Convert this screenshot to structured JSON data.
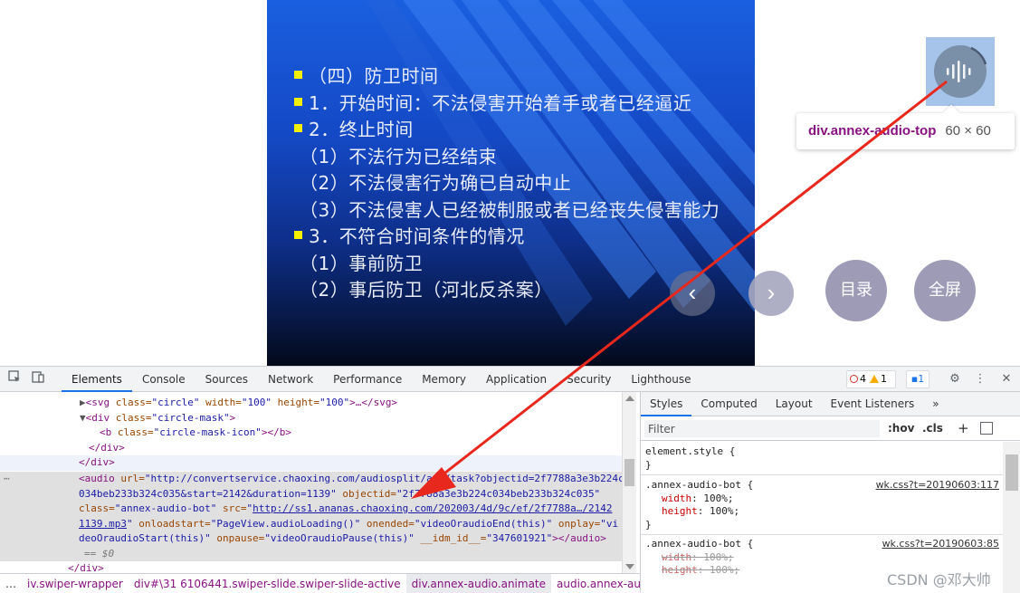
{
  "slide": {
    "lines": [
      {
        "text": "（四）防卫时间",
        "bullet": true
      },
      {
        "text": "1．开始时间：不法侵害开始着手或者已经逼近",
        "bullet": true
      },
      {
        "text": "2．终止时间",
        "bullet": true
      },
      {
        "text": "（1）不法行为已经结束",
        "bullet": false
      },
      {
        "text": "（2）不法侵害行为确已自动中止",
        "bullet": false
      },
      {
        "text": "（3）不法侵害人已经被制服或者已经丧失侵害能力",
        "bullet": false
      },
      {
        "text": "3．不符合时间条件的情况",
        "bullet": true
      },
      {
        "text": "（1）事前防卫",
        "bullet": false
      },
      {
        "text": "（2）事后防卫（河北反杀案）",
        "bullet": false
      }
    ],
    "bullet_color": "#f5f000",
    "text_color": "#e8ecf8"
  },
  "controls": {
    "prev_glyph": "‹",
    "next_glyph": "›",
    "catalog_label": "目录",
    "fullscreen_label": "全屏",
    "button_color": "#9e9bb7"
  },
  "audio_icon": {
    "name": "audio-wave-icon",
    "highlight_color": "#a6c4ea"
  },
  "tooltip": {
    "selector": "div.annex-audio-top",
    "size": "60 × 60"
  },
  "devtools": {
    "tabs": [
      "Elements",
      "Console",
      "Sources",
      "Network",
      "Performance",
      "Memory",
      "Application",
      "Security",
      "Lighthouse"
    ],
    "active_tab": "Elements",
    "errors": "4",
    "warnings": "1",
    "messages": "1",
    "elements": {
      "lines": {
        "l1_open": "<svg ",
        "l1_attr1": "class=",
        "l1_val1": "\"circle\"",
        "l1_attr2": " width=",
        "l1_val2": "\"100\"",
        "l1_attr3": " height=",
        "l1_val3": "\"100\"",
        "l1_close": ">…</svg>",
        "l2_open": "<div ",
        "l2_attr": "class=",
        "l2_val": "\"circle-mask\"",
        "l2_close": ">",
        "l3_open": "<b ",
        "l3_attr": "class=",
        "l3_val": "\"circle-mask-icon\"",
        "l3_close": "></b>",
        "l4": "</div>",
        "l5": "</div>",
        "a1_open": "<audio ",
        "a1_attr": "url=",
        "a1_val": "\"http://convertservice.chaoxing.com/audiosplit/api/task?objectid=2f7788a3e3b224c",
        "a2_val": "034beb233b324c035&start=2142&duration=1139\"",
        "a2_attr": " objectid=",
        "a2_val2": "\"2f7788a3e3b224c034beb233b324c035\"",
        "a3_attr": "class=",
        "a3_val": "\"annex-audio-bot\"",
        "a3_attr2": " src=",
        "a3_link": "http://ss1.ananas.chaoxing.com/202003/4d/9c/ef/2f7788a…/2142",
        "a4_link": "1139.mp3",
        "a4_attr": " onloadstart=",
        "a4_val": "\"PageView.audioLoading()\"",
        "a4_attr2": " onended=",
        "a4_val2": "\"videoOraudioEnd(this)\"",
        "a4_attr3": " onplay=",
        "a4_val3": "\"vi",
        "a5_val": "deoOraudioStart(this)\"",
        "a5_attr": " onpause=",
        "a5_val2": "\"videoOraudioPause(this)\"",
        "a5_attr2": " __idm_id__=",
        "a5_val3": "\"347601921\"",
        "a5_close": "></audio>",
        "a6": "== $0",
        "l_last": "</div>"
      }
    },
    "breadcrumbs": [
      "…",
      "iv.swiper-wrapper",
      "div#\\31 6106441.swiper-slide.swiper-slide-active",
      "div.annex-audio.animate",
      "audio.annex-audio-bot",
      "…"
    ],
    "styles": {
      "tabs": [
        "Styles",
        "Computed",
        "Layout",
        "Event Listeners",
        "»"
      ],
      "active_tab": "Styles",
      "filter_placeholder": "Filter",
      "hov": ":hov",
      "cls": ".cls",
      "plus": "+",
      "element_style": "element.style {",
      "brace_close": "}",
      "rule1_selector": ".annex-audio-bot {",
      "rule1_source": "wk.css?t=20190603:117",
      "rule1_props": [
        {
          "prop": "width",
          "value": "100%;"
        },
        {
          "prop": "height",
          "value": "100%;"
        }
      ],
      "rule2_selector": ".annex-audio-bot {",
      "rule2_source": "wk.css?t=20190603:85",
      "rule2_props": [
        {
          "prop": "width",
          "value": "100%;"
        },
        {
          "prop": "height",
          "value": "100%;"
        }
      ]
    }
  },
  "watermark": "CSDN @邓大帅",
  "annotation_arrow_color": "#e8271d"
}
